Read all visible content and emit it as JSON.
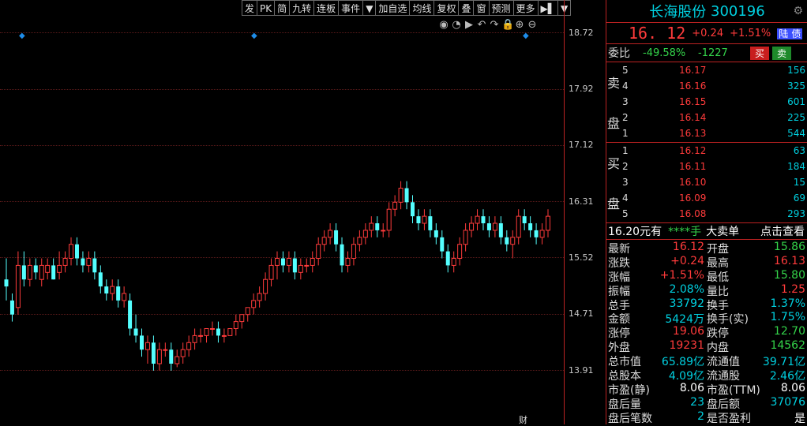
{
  "toolbar": [
    "发",
    "PK",
    "简",
    "九转",
    "连板",
    "事件",
    "▼",
    "加自选",
    "均线",
    "复权",
    "叠",
    "窗",
    "预测",
    "更多",
    "▶▌",
    "▼"
  ],
  "chart_icons": [
    "eye-icon",
    "clock-icon",
    "play-icon",
    "undo-icon",
    "redo-icon",
    "lock-icon",
    "zoom-in-icon",
    "zoom-out-icon"
  ],
  "chart_icon_glyphs": [
    "◉",
    "◔",
    "▶",
    "↶",
    "↷",
    "🔒",
    "⊕",
    "⊖"
  ],
  "axis_labels": [
    "18.72",
    "17.92",
    "17.12",
    "16.31",
    "15.52",
    "14.71",
    "13.91"
  ],
  "marker_label": "财",
  "stock": {
    "name": "长海股份",
    "code": "300196"
  },
  "price": {
    "last": "16. 12",
    "change": "+0.24",
    "pct": "+1.51%",
    "badge1": "陆",
    "badge2": "债"
  },
  "weibi": {
    "label": "委比",
    "ratio": "-49.58%",
    "diff": "-1227",
    "buy": "买",
    "sell": "卖"
  },
  "sell_side": "卖盘",
  "buy_side": "买盘",
  "asks": [
    {
      "n": "5",
      "p": "16.17",
      "v": "156"
    },
    {
      "n": "4",
      "p": "16.16",
      "v": "325"
    },
    {
      "n": "3",
      "p": "16.15",
      "v": "601"
    },
    {
      "n": "2",
      "p": "16.14",
      "v": "225"
    },
    {
      "n": "1",
      "p": "16.13",
      "v": "544"
    }
  ],
  "bids": [
    {
      "n": "1",
      "p": "16.12",
      "v": "63"
    },
    {
      "n": "2",
      "p": "16.11",
      "v": "184"
    },
    {
      "n": "3",
      "p": "16.10",
      "v": "15"
    },
    {
      "n": "4",
      "p": "16.09",
      "v": "69"
    },
    {
      "n": "5",
      "p": "16.08",
      "v": "293"
    }
  ],
  "big_order": {
    "prefix": "16.20元有",
    "stars": "****手",
    "type": "大卖单",
    "link": "点击查看"
  },
  "stats": [
    {
      "l1": "最新",
      "v1": "16.12",
      "c1": "red",
      "l2": "开盘",
      "v2": "15.86",
      "c2": "green"
    },
    {
      "l1": "涨跌",
      "v1": "+0.24",
      "c1": "red",
      "l2": "最高",
      "v2": "16.13",
      "c2": "red"
    },
    {
      "l1": "涨幅",
      "v1": "+1.51%",
      "c1": "red",
      "l2": "最低",
      "v2": "15.80",
      "c2": "green"
    },
    {
      "l1": "振幅",
      "v1": "2.08%",
      "c1": "cyan",
      "l2": "量比",
      "v2": "1.25",
      "c2": "red"
    },
    {
      "l1": "总手",
      "v1": "33792",
      "c1": "cyan",
      "l2": "换手",
      "v2": "1.37%",
      "c2": "cyan"
    },
    {
      "l1": "金额",
      "v1": "5424万",
      "c1": "cyan",
      "l2": "换手(实)",
      "v2": "1.75%",
      "c2": "cyan"
    },
    {
      "l1": "涨停",
      "v1": "19.06",
      "c1": "red",
      "l2": "跌停",
      "v2": "12.70",
      "c2": "green"
    },
    {
      "l1": "外盘",
      "v1": "19231",
      "c1": "red",
      "l2": "内盘",
      "v2": "14562",
      "c2": "green"
    },
    {
      "l1": "总市值",
      "v1": "65.89亿",
      "c1": "cyan",
      "l2": "流通值",
      "v2": "39.71亿",
      "c2": "cyan"
    },
    {
      "l1": "总股本",
      "v1": "4.09亿",
      "c1": "cyan",
      "l2": "流通股",
      "v2": "2.46亿",
      "c2": "cyan"
    },
    {
      "l1": "市盈(静)",
      "v1": "8.06",
      "c1": "white",
      "l2": "市盈(TTM)",
      "v2": "8.06",
      "c2": "white"
    },
    {
      "l1": "盘后量",
      "v1": "23",
      "c1": "cyan",
      "l2": "盘后额",
      "v2": "37076",
      "c2": "cyan"
    },
    {
      "l1": "盘后笔数",
      "v1": "2",
      "c1": "cyan",
      "l2": "是否盈利",
      "v2": "是",
      "c2": "white"
    }
  ],
  "chart_data": {
    "type": "candlestick",
    "ylim": [
      13.6,
      19.0
    ],
    "colors": {
      "up": "#ff3b3b",
      "down": "#54ffff"
    },
    "candles": [
      [
        15.2,
        15.5,
        14.9,
        15.1
      ],
      [
        14.9,
        15.0,
        14.6,
        14.7
      ],
      [
        14.8,
        15.6,
        14.7,
        15.4
      ],
      [
        15.4,
        15.6,
        15.1,
        15.2
      ],
      [
        15.2,
        15.5,
        15.1,
        15.4
      ],
      [
        15.4,
        15.5,
        15.2,
        15.3
      ],
      [
        15.2,
        15.5,
        15.1,
        15.4
      ],
      [
        15.3,
        15.5,
        15.2,
        15.4
      ],
      [
        15.4,
        15.5,
        15.2,
        15.2
      ],
      [
        15.3,
        15.6,
        15.2,
        15.4
      ],
      [
        15.4,
        15.6,
        15.3,
        15.5
      ],
      [
        15.5,
        15.8,
        15.4,
        15.7
      ],
      [
        15.7,
        15.8,
        15.4,
        15.5
      ],
      [
        15.5,
        15.6,
        15.3,
        15.4
      ],
      [
        15.4,
        15.6,
        15.3,
        15.5
      ],
      [
        15.5,
        15.6,
        15.2,
        15.3
      ],
      [
        15.3,
        15.4,
        15.0,
        15.1
      ],
      [
        15.1,
        15.2,
        14.9,
        15.0
      ],
      [
        15.0,
        15.2,
        14.9,
        15.1
      ],
      [
        15.1,
        15.2,
        14.8,
        14.9
      ],
      [
        14.9,
        15.1,
        14.8,
        15.0
      ],
      [
        14.9,
        15.0,
        14.4,
        14.5
      ],
      [
        14.5,
        14.7,
        14.3,
        14.4
      ],
      [
        14.4,
        14.5,
        14.1,
        14.2
      ],
      [
        14.2,
        14.4,
        14.0,
        14.3
      ],
      [
        14.3,
        14.4,
        13.9,
        14.0
      ],
      [
        14.0,
        14.3,
        13.9,
        14.2
      ],
      [
        14.2,
        14.3,
        14.1,
        14.2
      ],
      [
        14.2,
        14.3,
        13.9,
        14.0
      ],
      [
        14.0,
        14.2,
        13.95,
        14.1
      ],
      [
        14.1,
        14.3,
        14.0,
        14.2
      ],
      [
        14.2,
        14.4,
        14.1,
        14.3
      ],
      [
        14.3,
        14.5,
        14.2,
        14.4
      ],
      [
        14.4,
        14.5,
        14.3,
        14.4
      ],
      [
        14.4,
        14.5,
        14.3,
        14.5
      ],
      [
        14.5,
        14.6,
        14.4,
        14.5
      ],
      [
        14.5,
        14.6,
        14.3,
        14.4
      ],
      [
        14.4,
        14.5,
        14.3,
        14.4
      ],
      [
        14.4,
        14.5,
        14.4,
        14.5
      ],
      [
        14.5,
        14.7,
        14.4,
        14.6
      ],
      [
        14.6,
        14.7,
        14.5,
        14.7
      ],
      [
        14.7,
        14.8,
        14.6,
        14.8
      ],
      [
        14.8,
        15.0,
        14.7,
        14.9
      ],
      [
        14.9,
        15.1,
        14.8,
        15.0
      ],
      [
        15.0,
        15.3,
        14.9,
        15.2
      ],
      [
        15.2,
        15.5,
        15.1,
        15.4
      ],
      [
        15.4,
        15.6,
        15.2,
        15.5
      ],
      [
        15.5,
        15.6,
        15.3,
        15.4
      ],
      [
        15.4,
        15.6,
        15.3,
        15.5
      ],
      [
        15.5,
        15.6,
        15.2,
        15.3
      ],
      [
        15.3,
        15.5,
        15.2,
        15.4
      ],
      [
        15.4,
        15.5,
        15.3,
        15.4
      ],
      [
        15.4,
        15.6,
        15.3,
        15.5
      ],
      [
        15.5,
        15.8,
        15.4,
        15.7
      ],
      [
        15.7,
        15.9,
        15.6,
        15.8
      ],
      [
        15.8,
        16.0,
        15.7,
        15.9
      ],
      [
        15.9,
        16.0,
        15.6,
        15.7
      ],
      [
        15.7,
        15.8,
        15.3,
        15.4
      ],
      [
        15.4,
        15.6,
        15.3,
        15.5
      ],
      [
        15.5,
        15.8,
        15.4,
        15.7
      ],
      [
        15.7,
        15.9,
        15.6,
        15.8
      ],
      [
        15.8,
        16.0,
        15.7,
        15.9
      ],
      [
        15.9,
        16.1,
        15.8,
        16.0
      ],
      [
        16.0,
        16.1,
        15.8,
        15.9
      ],
      [
        15.9,
        16.0,
        15.8,
        15.9
      ],
      [
        15.9,
        16.3,
        15.8,
        16.2
      ],
      [
        16.2,
        16.4,
        16.1,
        16.3
      ],
      [
        16.3,
        16.6,
        16.2,
        16.5
      ],
      [
        16.5,
        16.6,
        16.2,
        16.3
      ],
      [
        16.3,
        16.4,
        16.0,
        16.1
      ],
      [
        16.1,
        16.2,
        15.9,
        16.0
      ],
      [
        16.0,
        16.2,
        15.9,
        16.1
      ],
      [
        16.1,
        16.2,
        15.8,
        15.9
      ],
      [
        15.9,
        16.0,
        15.7,
        15.8
      ],
      [
        15.8,
        15.9,
        15.5,
        15.6
      ],
      [
        15.6,
        15.7,
        15.3,
        15.4
      ],
      [
        15.4,
        15.6,
        15.3,
        15.5
      ],
      [
        15.5,
        15.8,
        15.4,
        15.7
      ],
      [
        15.7,
        16.0,
        15.6,
        15.9
      ],
      [
        15.9,
        16.1,
        15.8,
        16.0
      ],
      [
        16.0,
        16.2,
        15.9,
        16.1
      ],
      [
        16.1,
        16.2,
        15.9,
        16.0
      ],
      [
        16.0,
        16.1,
        15.8,
        15.9
      ],
      [
        15.9,
        16.1,
        15.8,
        16.0
      ],
      [
        16.0,
        16.1,
        15.7,
        15.8
      ],
      [
        15.8,
        15.9,
        15.6,
        15.7
      ],
      [
        15.7,
        15.9,
        15.5,
        15.8
      ],
      [
        15.8,
        16.2,
        15.7,
        16.1
      ],
      [
        16.1,
        16.2,
        15.9,
        16.0
      ],
      [
        16.0,
        16.1,
        15.8,
        15.9
      ],
      [
        15.9,
        16.0,
        15.7,
        15.8
      ],
      [
        15.8,
        16.0,
        15.7,
        15.9
      ],
      [
        15.9,
        16.2,
        15.8,
        16.1
      ]
    ]
  }
}
